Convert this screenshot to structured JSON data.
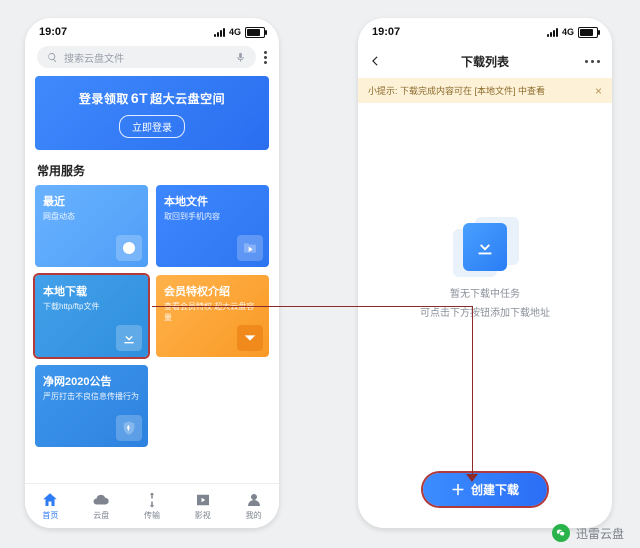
{
  "left": {
    "statusbar": {
      "time": "19:07",
      "net": "4G"
    },
    "search": {
      "placeholder": "搜索云盘文件"
    },
    "promo": {
      "prefix": "登录领取",
      "big": "6T",
      "suffix": "超大云盘空间",
      "button": "立即登录"
    },
    "section_title": "常用服务",
    "tiles": {
      "recent": {
        "title": "最近",
        "sub": "网盘动态"
      },
      "local": {
        "title": "本地文件",
        "sub": "取回到手机内容"
      },
      "download": {
        "title": "本地下载",
        "sub": "下载http/ftp文件"
      },
      "vip": {
        "title": "会员特权介绍",
        "sub": "查看会员特权  超大云盘容量"
      },
      "notice": {
        "title": "净网2020公告",
        "sub": "严厉打击不良信息传播行为"
      }
    },
    "tabs": [
      "首页",
      "云盘",
      "传输",
      "影视",
      "我的"
    ],
    "active_tab_index": 0
  },
  "right": {
    "statusbar": {
      "time": "19:07",
      "net": "4G"
    },
    "title": "下载列表",
    "tip": "小提示: 下载完成内容可在 [本地文件] 中查看",
    "empty": {
      "line1": "暂无下载中任务",
      "line2": "可点击下方按钮添加下载地址"
    },
    "primary_button": "创建下载"
  },
  "watermark": "迅雷云盘"
}
